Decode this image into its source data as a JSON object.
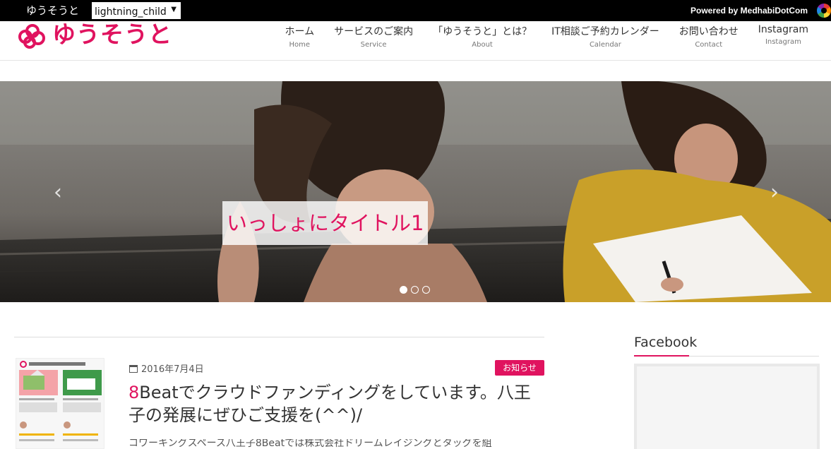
{
  "topbar": {
    "site_title": "ゆうそうと",
    "theme_select_value": "lightning_child",
    "powered_by": "Powered by MedhabiDotCom"
  },
  "header": {
    "logo_text": "ゆうそうと",
    "nav": [
      {
        "ja": "ホーム",
        "en": "Home"
      },
      {
        "ja": "サービスのご案内",
        "en": "Service"
      },
      {
        "ja": "「ゆうそうと」とは？",
        "en": "About"
      },
      {
        "ja": "IT相談ご予約カレンダー",
        "en": "Calendar"
      },
      {
        "ja": "お問い合わせ",
        "en": "Contact"
      },
      {
        "ja": "Instagram",
        "en": "Instagram"
      }
    ]
  },
  "slider": {
    "caption": "いっしょにタイトル1",
    "prev_icon": "‹",
    "next_icon": "›",
    "current_slide": 1,
    "slide_count": 3
  },
  "post": {
    "date": "2016年7月4日",
    "category": "お知らせ",
    "title_accent": "8",
    "title_rest": "Beatでクラウドファンディングをしています。八王子の発展にぜひご支援を(^^)/",
    "excerpt": "コワーキングスペース八王子8Beatでは株式会社ドリームレイジングとタッグを組"
  },
  "sidebar": {
    "widget_title": "Facebook"
  },
  "colors": {
    "accent": "#e0135f",
    "topbar": "#000000"
  }
}
